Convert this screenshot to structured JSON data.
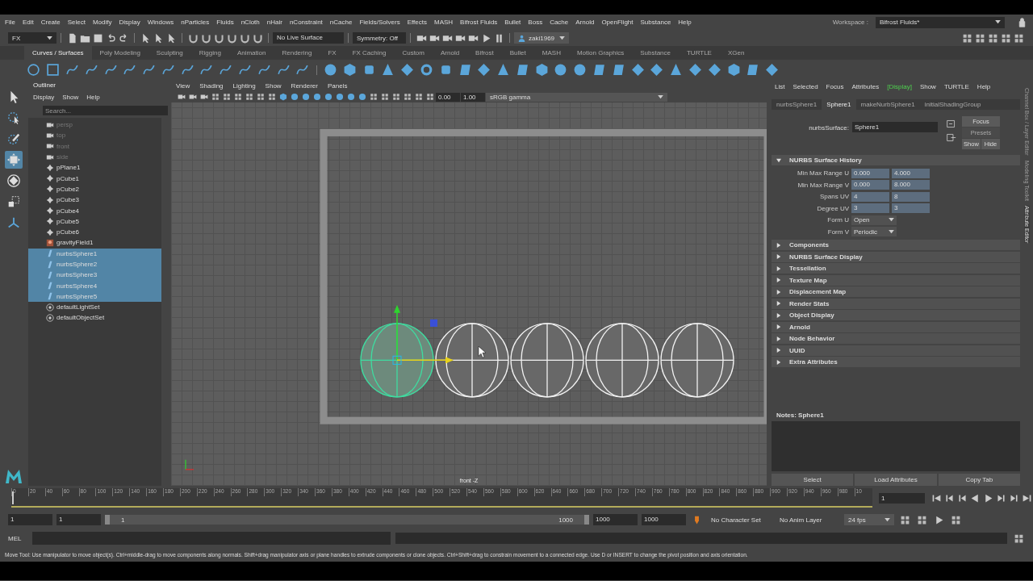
{
  "menu_bar": [
    "File",
    "Edit",
    "Create",
    "Select",
    "Modify",
    "Display",
    "Windows",
    "nParticles",
    "Fluids",
    "nCloth",
    "nHair",
    "nConstraint",
    "nCache",
    "Fields/Solvers",
    "Effects",
    "MASH",
    "Bifrost Fluids",
    "Bullet",
    "Boss",
    "Cache",
    "Arnold",
    "OpenFlight",
    "Substance",
    "Help"
  ],
  "workspace": {
    "label": "Workspace :",
    "value": "Bifrost Fluids*"
  },
  "status_line": {
    "menu_set": "FX",
    "live_surface": "No Live Surface",
    "symmetry": "Symmetry: Off",
    "user": "zaki1969"
  },
  "shelf_tabs": [
    {
      "label": "Curves / Surfaces",
      "selected": true
    },
    {
      "label": "Poly Modeling",
      "selected": false
    },
    {
      "label": "Sculpting",
      "selected": false
    },
    {
      "label": "Rigging",
      "selected": false
    },
    {
      "label": "Animation",
      "selected": false
    },
    {
      "label": "Rendering",
      "selected": false
    },
    {
      "label": "FX",
      "selected": false
    },
    {
      "label": "FX Caching",
      "selected": false
    },
    {
      "label": "Custom",
      "selected": false
    },
    {
      "label": "Arnold",
      "selected": false
    },
    {
      "label": "Bifrost",
      "selected": false
    },
    {
      "label": "Bullet",
      "selected": false
    },
    {
      "label": "MASH",
      "selected": false
    },
    {
      "label": "Motion Graphics",
      "selected": false
    },
    {
      "label": "Substance",
      "selected": false
    },
    {
      "label": "TURTLE",
      "selected": false
    },
    {
      "label": "XGen",
      "selected": false
    }
  ],
  "toolbox": [
    {
      "kind": "select",
      "selected": false
    },
    {
      "kind": "lasso",
      "selected": false
    },
    {
      "kind": "paint",
      "selected": false
    },
    {
      "kind": "move",
      "selected": true
    },
    {
      "kind": "rotate",
      "selected": false
    },
    {
      "kind": "scale",
      "selected": false
    },
    {
      "kind": "manipulator",
      "selected": false
    }
  ],
  "outliner": {
    "title": "Outliner",
    "menu": [
      "Display",
      "Show",
      "Help"
    ],
    "search": {
      "placeholder": "Search..."
    },
    "items": [
      {
        "label": "persp",
        "kind": "camera",
        "dimmed": true,
        "selected": false
      },
      {
        "label": "top",
        "kind": "camera",
        "dimmed": true,
        "selected": false
      },
      {
        "label": "front",
        "kind": "camera",
        "dimmed": true,
        "selected": false
      },
      {
        "label": "side",
        "kind": "camera",
        "dimmed": true,
        "selected": false
      },
      {
        "label": "pPlane1",
        "kind": "transform",
        "dimmed": false,
        "selected": false
      },
      {
        "label": "pCube1",
        "kind": "transform",
        "dimmed": false,
        "selected": false
      },
      {
        "label": "pCube2",
        "kind": "transform",
        "dimmed": false,
        "selected": false
      },
      {
        "label": "pCube3",
        "kind": "transform",
        "dimmed": false,
        "selected": false
      },
      {
        "label": "pCube4",
        "kind": "transform",
        "dimmed": false,
        "selected": false
      },
      {
        "label": "pCube5",
        "kind": "transform",
        "dimmed": false,
        "selected": false
      },
      {
        "label": "pCube6",
        "kind": "transform",
        "dimmed": false,
        "selected": false
      },
      {
        "label": "gravityField1",
        "kind": "field",
        "dimmed": false,
        "selected": false
      },
      {
        "label": "nurbsSphere1",
        "kind": "nurbs",
        "dimmed": false,
        "selected": true
      },
      {
        "label": "nurbsSphere2",
        "kind": "nurbs",
        "dimmed": false,
        "selected": true
      },
      {
        "label": "nurbsSphere3",
        "kind": "nurbs",
        "dimmed": false,
        "selected": true
      },
      {
        "label": "nurbsSphere4",
        "kind": "nurbs",
        "dimmed": false,
        "selected": true
      },
      {
        "label": "nurbsSphere5",
        "kind": "nurbs",
        "dimmed": false,
        "selected": true
      },
      {
        "label": "defaultLightSet",
        "kind": "set",
        "dimmed": false,
        "selected": false
      },
      {
        "label": "defaultObjectSet",
        "kind": "set",
        "dimmed": false,
        "selected": false
      }
    ]
  },
  "viewport": {
    "menu": [
      "View",
      "Shading",
      "Lighting",
      "Show",
      "Renderer",
      "Panels"
    ],
    "exposure": "0.00",
    "gamma": "1.00",
    "color_space": "sRGB gamma",
    "camera_label": "front -Z",
    "spheres": [
      {
        "lead": true
      },
      {
        "lead": false
      },
      {
        "lead": false
      },
      {
        "lead": false
      },
      {
        "lead": false
      }
    ]
  },
  "attribute_editor": {
    "menu": [
      {
        "label": "List",
        "highlighted": false
      },
      {
        "label": "Selected",
        "highlighted": false
      },
      {
        "label": "Focus",
        "highlighted": false
      },
      {
        "label": "Attributes",
        "highlighted": false
      },
      {
        "label": "[Display]",
        "highlighted": true
      },
      {
        "label": "Show",
        "highlighted": false
      },
      {
        "label": "TURTLE",
        "highlighted": false
      },
      {
        "label": "Help",
        "highlighted": false
      }
    ],
    "tabs": [
      {
        "label": "nurbsSphere1",
        "selected": false
      },
      {
        "label": "Sphere1",
        "selected": true
      },
      {
        "label": "makeNurbSphere1",
        "selected": false
      },
      {
        "label": "initialShadingGroup",
        "selected": false
      }
    ],
    "node_label": "nurbsSurface:",
    "node_name": "Sphere1",
    "buttons": [
      {
        "label": "Focus",
        "disabled": false
      },
      {
        "label": "Presets",
        "disabled": true
      },
      {
        "label": "Show",
        "disabled": false
      },
      {
        "label": "Hide",
        "disabled": false
      }
    ],
    "sections": [
      {
        "title": "NURBS Surface History",
        "expanded": true,
        "fields": [
          {
            "label": "Min Max Range U",
            "kind": "pair",
            "values": [
              "0.000",
              "4.000"
            ]
          },
          {
            "label": "Min Max Range V",
            "kind": "pair",
            "values": [
              "0.000",
              "8.000"
            ]
          },
          {
            "label": "Spans UV",
            "kind": "pair",
            "values": [
              "4",
              "8"
            ]
          },
          {
            "label": "Degree UV",
            "kind": "pair",
            "values": [
              "3",
              "3"
            ]
          },
          {
            "label": "Form U",
            "kind": "dropdown",
            "value": "Open"
          },
          {
            "label": "Form V",
            "kind": "dropdown",
            "value": "Periodic"
          }
        ]
      },
      {
        "title": "Components",
        "expanded": false
      },
      {
        "title": "NURBS Surface Display",
        "expanded": false
      },
      {
        "title": "Tessellation",
        "expanded": false
      },
      {
        "title": "Texture Map",
        "expanded": false
      },
      {
        "title": "Displacement Map",
        "expanded": false
      },
      {
        "title": "Render Stats",
        "expanded": false
      },
      {
        "title": "Object Display",
        "expanded": false
      },
      {
        "title": "Arnold",
        "expanded": false
      },
      {
        "title": "Node Behavior",
        "expanded": false
      },
      {
        "title": "UUID",
        "expanded": false
      },
      {
        "title": "Extra Attributes",
        "expanded": false
      }
    ],
    "notes_label": "Notes:  Sphere1",
    "bottom_buttons": [
      "Select",
      "Load Attributes",
      "Copy Tab"
    ]
  },
  "side_tabs": [
    {
      "label": "Channel Box / Layer Editor",
      "selected": false
    },
    {
      "label": "Modeling Toolkit",
      "selected": false
    },
    {
      "label": "Attribute Editor",
      "selected": true
    }
  ],
  "timeline": {
    "ticks": [
      "0",
      "20",
      "40",
      "60",
      "80",
      "100",
      "120",
      "140",
      "160",
      "180",
      "200",
      "220",
      "240",
      "260",
      "280",
      "300",
      "320",
      "340",
      "360",
      "380",
      "400",
      "420",
      "440",
      "460",
      "480",
      "500",
      "520",
      "540",
      "560",
      "580",
      "600",
      "620",
      "640",
      "660",
      "680",
      "700",
      "720",
      "740",
      "760",
      "780",
      "800",
      "820",
      "840",
      "860",
      "880",
      "900",
      "920",
      "940",
      "960",
      "980",
      "10"
    ],
    "current_frame": "1",
    "level": 0.001
  },
  "range": {
    "start": "1",
    "playback_start": "1",
    "slider_start": "1",
    "slider_end": "1000",
    "level": 1,
    "playback_end": "1000",
    "end": "1000",
    "character_set": "No Character Set",
    "anim_layer": "No Anim Layer",
    "fps": "24 fps"
  },
  "command_line": {
    "label": "MEL"
  },
  "help_line": "Move Tool: Use manipulator to move object(s). Ctrl+middle-drag to move components along normals. Shift+drag manipulator axis or plane handles to extrude components or clone objects. Ctrl+Shift+drag to constrain movement to a connected edge. Use D or INSERT to change the pivot position and axis orientation."
}
